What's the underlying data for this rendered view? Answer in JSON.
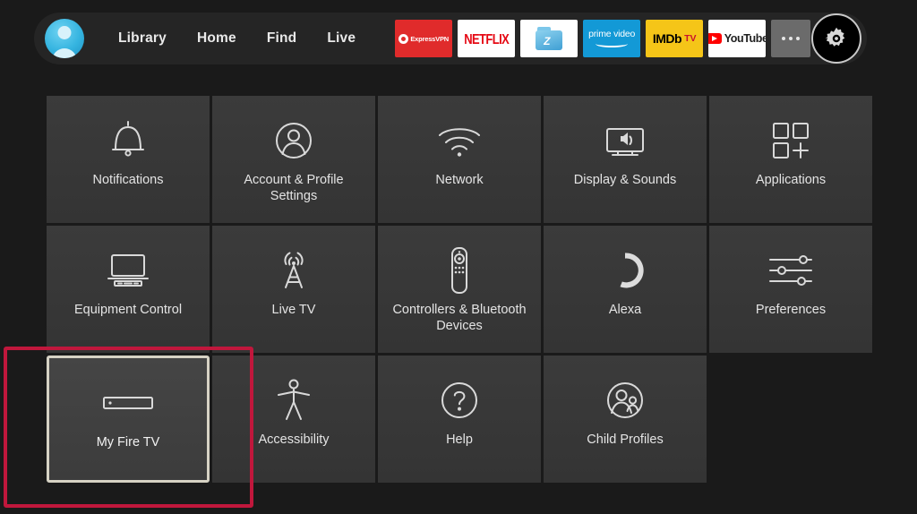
{
  "nav": {
    "avatar_name": "profile-avatar",
    "links": [
      {
        "label": "Library"
      },
      {
        "label": "Home"
      },
      {
        "label": "Find"
      },
      {
        "label": "Live"
      }
    ],
    "apps": [
      {
        "name": "expressvpn",
        "label": "ExpressVPN",
        "bg": "#e02b2b"
      },
      {
        "name": "netflix",
        "label": "NETFLIX",
        "bg": "#ffffff"
      },
      {
        "name": "file-manager",
        "label": "",
        "bg": "#ffffff"
      },
      {
        "name": "prime-video",
        "label": "prime video",
        "bg": "#1399d6"
      },
      {
        "name": "imdb-tv",
        "label": "IMDb",
        "label2": "TV",
        "bg": "#f5c518"
      },
      {
        "name": "youtube",
        "label": "YouTube",
        "bg": "#ffffff"
      }
    ],
    "more_label": "•••",
    "settings_label": "Settings"
  },
  "settings_grid": {
    "rows": [
      [
        {
          "id": "notifications",
          "label": "Notifications",
          "icon": "bell-icon"
        },
        {
          "id": "account-profile-settings",
          "label": "Account & Profile Settings",
          "icon": "person-circle-icon"
        },
        {
          "id": "network",
          "label": "Network",
          "icon": "wifi-icon"
        },
        {
          "id": "display-sounds",
          "label": "Display & Sounds",
          "icon": "tv-speaker-icon"
        },
        {
          "id": "applications",
          "label": "Applications",
          "icon": "app-grid-plus-icon"
        }
      ],
      [
        {
          "id": "equipment-control",
          "label": "Equipment Control",
          "icon": "tv-soundbar-icon"
        },
        {
          "id": "live-tv",
          "label": "Live TV",
          "icon": "broadcast-tower-icon"
        },
        {
          "id": "controllers-bluetooth-devices",
          "label": "Controllers & Bluetooth Devices",
          "icon": "remote-control-icon"
        },
        {
          "id": "alexa",
          "label": "Alexa",
          "icon": "alexa-ring-icon"
        },
        {
          "id": "preferences",
          "label": "Preferences",
          "icon": "sliders-icon"
        }
      ],
      [
        {
          "id": "my-fire-tv",
          "label": "My Fire TV",
          "icon": "fire-tv-stick-icon",
          "selected": true
        },
        {
          "id": "accessibility",
          "label": "Accessibility",
          "icon": "accessibility-person-icon"
        },
        {
          "id": "help",
          "label": "Help",
          "icon": "question-circle-icon"
        },
        {
          "id": "child-profiles",
          "label": "Child Profiles",
          "icon": "two-people-circle-icon"
        }
      ]
    ]
  },
  "annotation": {
    "name": "highlight-box-my-fire-tv",
    "color": "#c0173c"
  }
}
